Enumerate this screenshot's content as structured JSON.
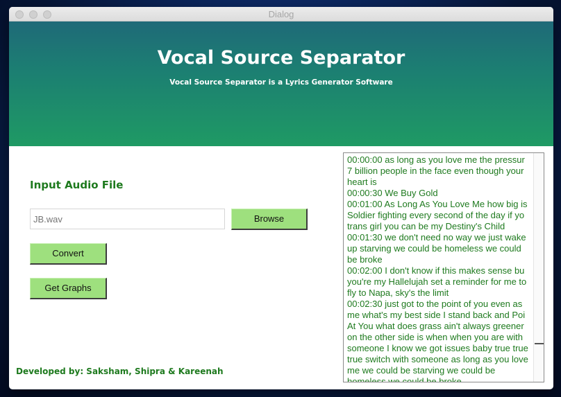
{
  "window": {
    "title": "Dialog"
  },
  "header": {
    "title": "Vocal Source Separator",
    "subtitle": "Vocal Source Separator is a Lyrics Generator Software"
  },
  "input_section": {
    "heading": "Input Audio File",
    "file_value": "",
    "file_placeholder": "JB.wav",
    "browse_label": "Browse",
    "convert_label": "Convert",
    "graphs_label": "Get Graphs"
  },
  "footer": {
    "credits": "Developed by: Saksham, Shipra & Kareenah"
  },
  "lyrics": {
    "lines": [
      "00:00:00 as long as you love me the pressur",
      "7 billion people in the face even though your",
      "heart is",
      "00:00:30 We Buy Gold",
      "00:01:00 As Long As You Love Me how big is",
      "Soldier fighting every second of the day if yo",
      "trans girl you can be my Destiny's Child",
      "00:01:30 we don't need no way we just wake",
      "up starving we could be homeless we could",
      "be broke",
      "00:02:00 I don't know if this makes sense bu",
      "you're my Hallelujah set a reminder for me to",
      "fly to Napa, sky's the limit",
      "00:02:30 just got to the point of you even as",
      "me what's my best side I stand back and Poi",
      "At You what does grass ain't always greener",
      "on the other side is when when you are with",
      "someone I know we got issues baby true true",
      "true switch with someone as long as you love",
      "me we could be starving we could be",
      "homeless we could be broke"
    ]
  },
  "colors": {
    "accent_green": "#1e7a1e",
    "button_green": "#9ee07e",
    "banner_top": "#1f6a78",
    "banner_bottom": "#1f9a64"
  }
}
